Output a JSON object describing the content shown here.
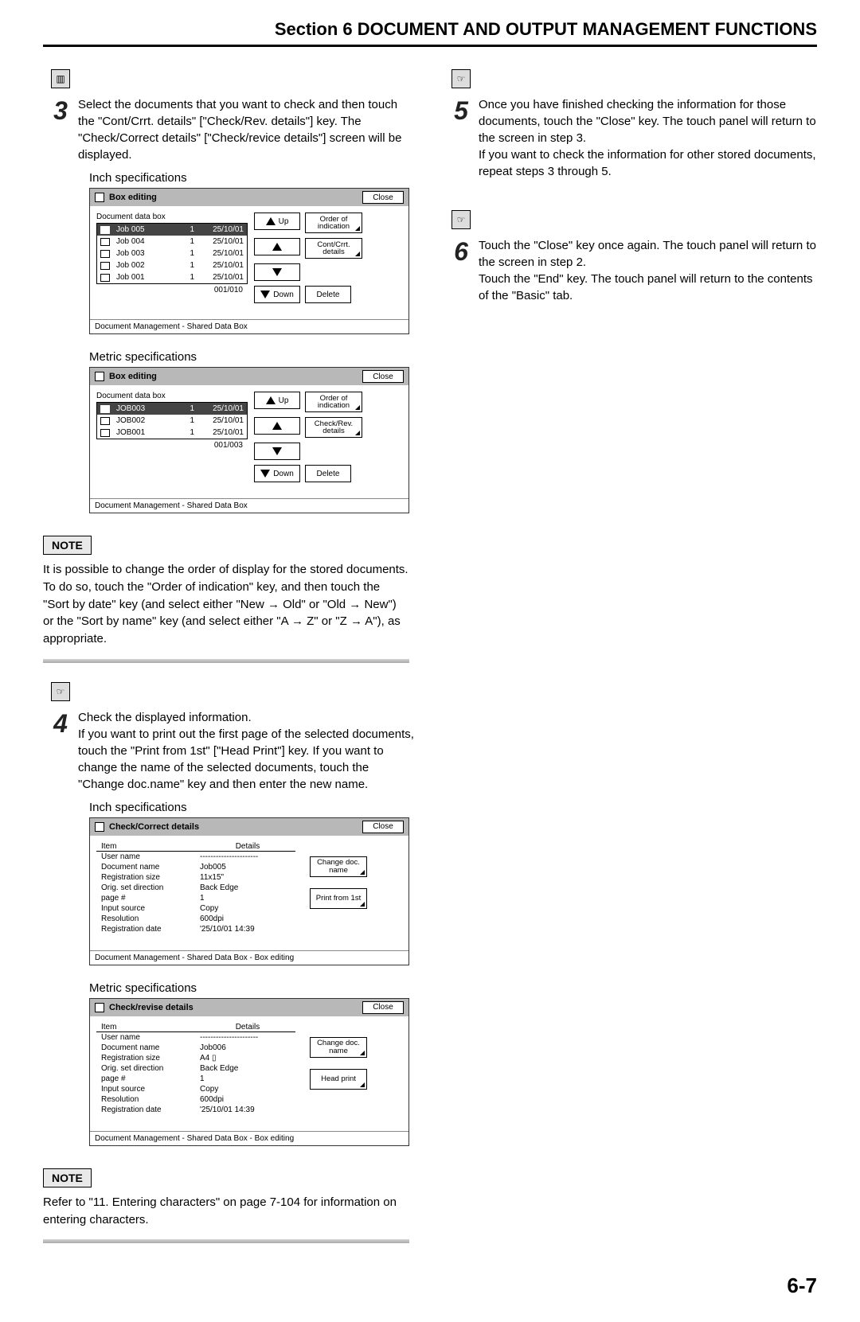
{
  "section_title": "Section 6  DOCUMENT AND OUTPUT MANAGEMENT FUNCTIONS",
  "page_number": "6-7",
  "captions": {
    "inch": "Inch specifications",
    "metric": "Metric specifications"
  },
  "steps": {
    "s3": "Select the documents that you want to check and then touch the \"Cont/Crrt. details\" [\"Check/Rev. details\"] key. The \"Check/Correct details\" [\"Check/revice details\"] screen will be displayed.",
    "s4": "Check the displayed information.\nIf you want to print out the first page of the selected documents, touch the \"Print from 1st\" [\"Head Print\"] key. If you want to change the name of the selected documents, touch the \"Change doc.name\" key and then enter the new name.",
    "s5": "Once you have finished checking the information for those documents, touch the \"Close\" key. The touch panel will return to the screen in step 3.\nIf you want to check the information for other stored documents, repeat steps 3 through 5.",
    "s6": "Touch the \"Close\" key once again. The touch panel will return to the screen in step 2.\nTouch the \"End\" key. The touch panel will return to the contents of the \"Basic\" tab."
  },
  "notes": {
    "label": "NOTE",
    "note1": "It is possible to change the order of display for the stored documents. To do so, touch the \"Order of indication\" key, and then touch the \"Sort by date\" key (and select either \"New → Old\" or \"Old → New\") or the \"Sort by name\" key (and select either \"A → Z\" or \"Z → A\"), as appropriate.",
    "note2": "Refer to \"11. Entering characters\" on page 7-104 for information on entering characters."
  },
  "panel_box": {
    "title": "Box editing",
    "close": "Close",
    "header_label": "Document data box",
    "crumb": "Document Management - Shared Data Box",
    "up": "Up",
    "down": "Down",
    "delete": "Delete",
    "order": "Order of indication",
    "cont": "Cont/Crrt. details",
    "check": "Check/Rev. details",
    "inch": {
      "rows": [
        {
          "name": "Job 005",
          "n": "1",
          "date": "25/10/01",
          "sel": true
        },
        {
          "name": "Job 004",
          "n": "1",
          "date": "25/10/01"
        },
        {
          "name": "Job 003",
          "n": "1",
          "date": "25/10/01"
        },
        {
          "name": "Job 002",
          "n": "1",
          "date": "25/10/01"
        },
        {
          "name": "Job 001",
          "n": "1",
          "date": "25/10/01"
        }
      ],
      "counter": "001/010"
    },
    "metric": {
      "rows": [
        {
          "name": "JOB003",
          "n": "1",
          "date": "25/10/01",
          "sel": true
        },
        {
          "name": "JOB002",
          "n": "1",
          "date": "25/10/01"
        },
        {
          "name": "JOB001",
          "n": "1",
          "date": "25/10/01"
        }
      ],
      "counter": "001/003"
    }
  },
  "panel_details": {
    "close": "Close",
    "item": "Item",
    "details": "Details",
    "change": "Change doc. name",
    "crumb": "Document Management - Shared Data Box - Box editing",
    "labels": [
      "User name",
      "Document name",
      "Registration size",
      "Orig. set direction",
      "page #",
      "Input source",
      "Resolution",
      "Registration date"
    ],
    "inch": {
      "title": "Check/Correct details",
      "print": "Print from 1st",
      "values": [
        "----------------------",
        "Job005",
        "11x15\"",
        "Back Edge",
        "1",
        "Copy",
        "600dpi",
        "'25/10/01 14:39"
      ]
    },
    "metric": {
      "title": "Check/revise details",
      "print": "Head print",
      "values": [
        "----------------------",
        "Job006",
        "A4 ▯",
        "Back Edge",
        "1",
        "Copy",
        "600dpi",
        "'25/10/01 14:39"
      ]
    }
  }
}
